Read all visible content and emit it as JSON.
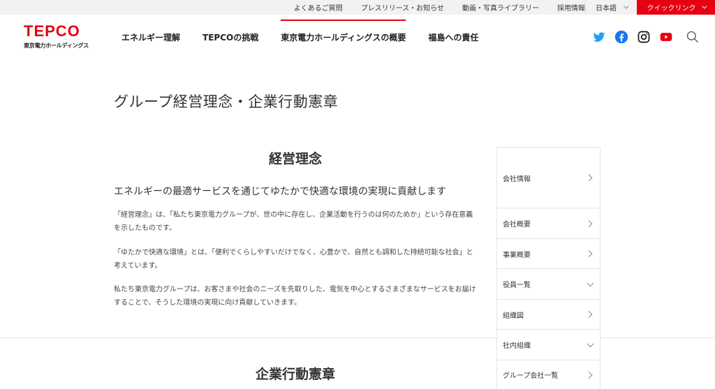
{
  "utility_bar": {
    "links": [
      "よくあるご質問",
      "プレスリリース・お知らせ",
      "動画・写真ライブラリー",
      "採用情報"
    ],
    "language": "日本語",
    "quick_link": "クイックリンク"
  },
  "header": {
    "logo_text": "TEPCO",
    "logo_subtext": "東京電力ホールディングス",
    "nav": [
      {
        "label": "エネルギー理解"
      },
      {
        "label": "TEPCOの挑戦"
      },
      {
        "label": "東京電力ホールディングスの概要",
        "active": true
      },
      {
        "label": "福島への責任"
      }
    ],
    "social_icons": [
      "twitter-icon",
      "facebook-icon",
      "instagram-icon",
      "youtube-icon",
      "search-icon"
    ]
  },
  "main": {
    "page_title": "グループ経営理念・企業行動憲章",
    "section1_title": "経営理念",
    "lead": "エネルギーの最適サービスを通じてゆたかで快適な環境の実現に貢献します",
    "paragraphs": [
      "「経営理念」は、「私たち東京電力グループが、世の中に存在し、企業活動を行うのは何のためか」という存在意義を示したものです。",
      "「ゆたかで快適な環境」とは、「便利でくらしやすいだけでなく、心豊かで、自然とも調和した持続可能な社会」と考えています。",
      "私たち東京電力グループは、お客さまや社会のニーズを先取りした、電気を中心とするさまざまなサービスをお届けすることで、そうした環境の実現に向け貢献していきます。"
    ],
    "section2_title": "企業行動憲章"
  },
  "sidenav": {
    "items": [
      {
        "label": "会社情報",
        "arrow": "right"
      },
      {
        "label": "会社概要",
        "arrow": "right"
      },
      {
        "label": "事業概要",
        "arrow": "right"
      },
      {
        "label": "役員一覧",
        "arrow": "down"
      },
      {
        "label": "組織図",
        "arrow": "right"
      },
      {
        "label": "社内組織",
        "arrow": "down"
      },
      {
        "label": "グループ会社一覧",
        "arrow": "right"
      }
    ]
  },
  "colors": {
    "brand_red": "#e60012",
    "utility_bg": "#f2f2f2"
  }
}
